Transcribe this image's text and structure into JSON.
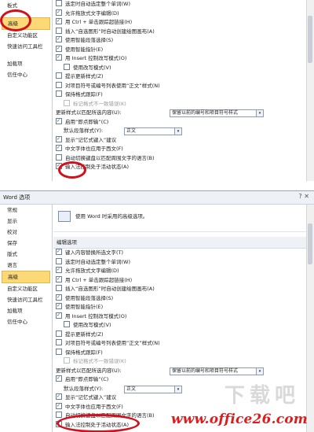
{
  "top": {
    "sidebar": [
      "板式",
      "",
      "高级",
      "自定义功能区",
      "快速访问工具栏",
      "",
      "加载项",
      "信任中心"
    ],
    "rows": [
      {
        "text": "选定时自动选定整个单词(W)",
        "checked": false
      },
      {
        "text": "允许拖放式文字编辑(D)",
        "checked": true
      },
      {
        "text": "用 Ctrl + 单击跟踪超链接(H)",
        "checked": true
      },
      {
        "text": "插入“自选图形”时自动创建绘图画布(A)",
        "checked": false
      },
      {
        "text": "使用智能段落选择(S)",
        "checked": true
      },
      {
        "text": "使用智能指针(E)",
        "checked": true
      },
      {
        "text": "用 Insert 控制改写模式(O)",
        "checked": true
      },
      {
        "text": "使用改写模式(V)",
        "checked": false,
        "indent": true
      },
      {
        "text": "提示更新样式(Z)",
        "checked": false
      },
      {
        "text": "对项目符号或编号列表使用“正文”样式(N)",
        "checked": false
      },
      {
        "text": "保持格式跟踪(F)",
        "checked": false
      },
      {
        "text": "标记格式不一致错误(K)",
        "checked": false,
        "indent": true,
        "gray": true
      }
    ],
    "paste_label": "更新样式以匹配所选内容(U):",
    "paste_value": "保留以前的编号和项目符号样式",
    "rows2": [
      {
        "text": "启用“即点即输”(C)",
        "checked": true
      },
      {
        "text": "默认段落样式(Y):",
        "checked": false,
        "nocheck": true,
        "combo": "正文"
      },
      {
        "text": "显示“记忆式键入”建议",
        "checked": true
      },
      {
        "text": "中文字体也应用于西文(F)",
        "checked": true
      },
      {
        "text": "自动切换键盘以匹配周围文字的语言(B)",
        "checked": false
      },
      {
        "text": "输入法控制处于活动状态(A)",
        "checked": true
      }
    ]
  },
  "bottom": {
    "window_title": "Word 选项",
    "window_buttons": "? ✕",
    "sidebar": [
      "常规",
      "显示",
      "校对",
      "保存",
      "版式",
      "语言",
      "高级",
      "自定义功能区",
      "快速访问工具栏",
      "加载项",
      "信任中心"
    ],
    "info": "使用 Word 时采用的高级选项。",
    "section": "编辑选项",
    "rows": [
      {
        "text": "键入内容替换所选文字(T)",
        "checked": true
      },
      {
        "text": "选定时自动选定整个单词(W)",
        "checked": false
      },
      {
        "text": "允许拖放式文字编辑(D)",
        "checked": true
      },
      {
        "text": "用 Ctrl + 单击跟踪超链接(H)",
        "checked": true
      },
      {
        "text": "插入“自选图形”时自动创建绘图画布(A)",
        "checked": false
      },
      {
        "text": "使用智能段落选择(S)",
        "checked": true
      },
      {
        "text": "使用智能指针(E)",
        "checked": true
      },
      {
        "text": "用 Insert 控制改写模式(O)",
        "checked": true
      },
      {
        "text": "使用改写模式(V)",
        "checked": false,
        "indent": true
      },
      {
        "text": "提示更新样式(Z)",
        "checked": false
      },
      {
        "text": "对项目符号或编号列表使用“正文”样式(N)",
        "checked": false
      },
      {
        "text": "保持格式跟踪(F)",
        "checked": false
      },
      {
        "text": "标记格式不一致错误(K)",
        "checked": false,
        "indent": true,
        "gray": true
      }
    ],
    "paste_label": "更新样式以匹配所选内容(U):",
    "paste_value": "保留以前的编号和项目符号样式",
    "rows2": [
      {
        "text": "启用“即点即输”(C)",
        "checked": true
      },
      {
        "text": "默认段落样式(Y):",
        "checked": false,
        "nocheck": true,
        "combo": "正文"
      },
      {
        "text": "显示“记忆式键入”建议",
        "checked": true
      },
      {
        "text": "中文字体也应用于西文(F)",
        "checked": true
      },
      {
        "text": "自动切换键盘以匹配周围文字的语言(B)",
        "checked": false
      },
      {
        "text": "输入法控制处于活动状态(A)",
        "checked": true
      }
    ]
  },
  "watermark": "www.office26.com",
  "watermark_faint": "下载吧"
}
